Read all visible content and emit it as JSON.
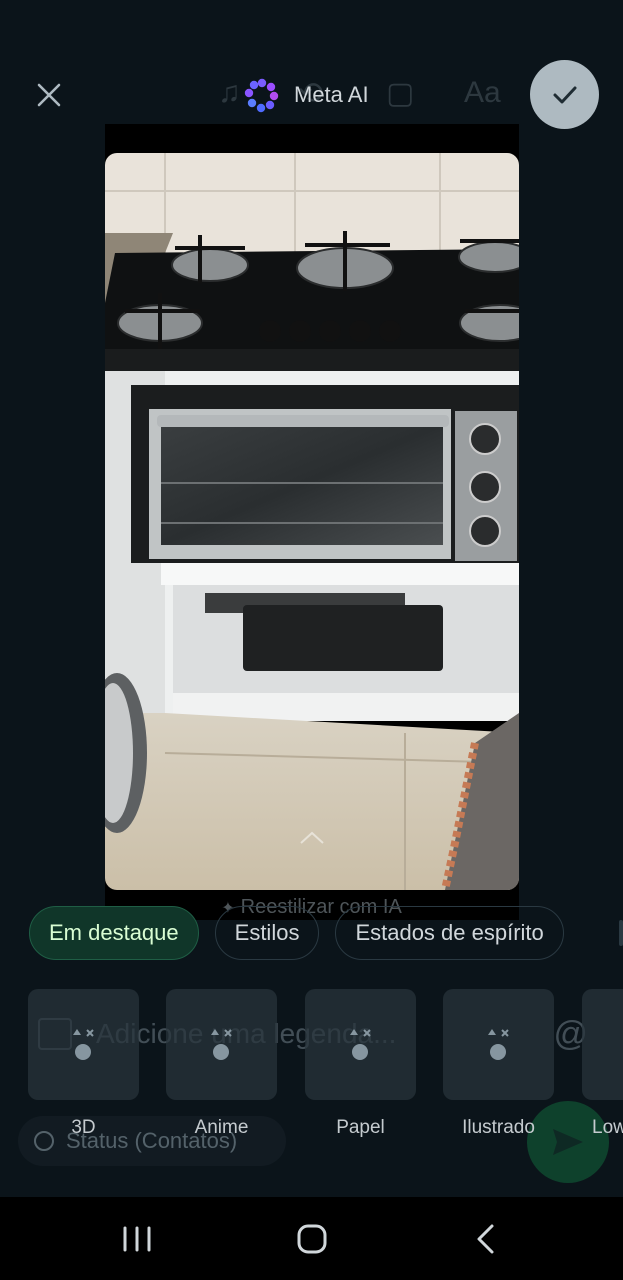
{
  "header": {
    "close_icon": "close-icon",
    "meta_ai_label": "Meta AI",
    "meta_ai_icon": "meta-ai-ring-icon",
    "confirm_icon": "checkmark-icon",
    "ghost_tools": [
      "music-icon",
      "sticker-icon",
      "crop-icon",
      "text-icon"
    ],
    "ghost_text_tool_label": "Aa"
  },
  "photo": {
    "subject": "photo-of-cooktop-and-oven"
  },
  "restyle": {
    "label": "Reestilizar com IA",
    "icon": "sparkle-icon"
  },
  "chips": [
    {
      "label": "Em destaque",
      "active": true
    },
    {
      "label": "Estilos",
      "active": false
    },
    {
      "label": "Estados de espírito",
      "active": false
    }
  ],
  "caption": {
    "placeholder": "Adicione uma legenda...",
    "at_icon": "at-icon",
    "add_image_icon": "add-image-icon"
  },
  "status_audience": {
    "label": "Status (Contatos)",
    "icon": "status-ring-icon"
  },
  "send": {
    "icon": "send-icon"
  },
  "style_tiles": [
    {
      "label": "3D"
    },
    {
      "label": "Anime"
    },
    {
      "label": "Papel"
    },
    {
      "label": "Ilustrado"
    },
    {
      "label": "Low"
    }
  ],
  "colors": {
    "background": "#0b141a",
    "chip_active_bg": "#103629",
    "chip_active_text": "#d9fdd3",
    "confirm_button": "#aebac1",
    "send_button": "#0f5132"
  },
  "navbar": {
    "items": [
      "recents-icon",
      "home-icon",
      "back-icon"
    ]
  }
}
